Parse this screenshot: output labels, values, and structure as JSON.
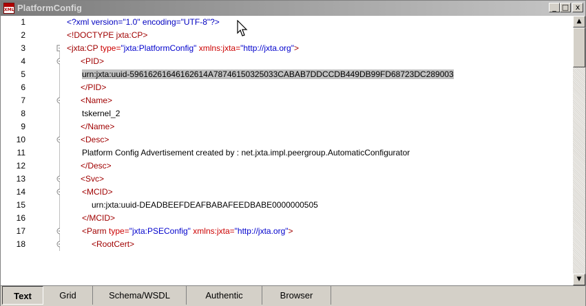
{
  "window": {
    "title": "PlatformConfig",
    "icon": "xml-file-icon",
    "icon_text": "XML",
    "controls": {
      "minimize": "_",
      "maximize": "□",
      "close": "x"
    }
  },
  "lines": [
    {
      "n": "1",
      "fold": "none",
      "indent": 0,
      "parts": [
        {
          "c": "pi",
          "t": "<?xml version=\"1.0\" encoding=\"UTF-8\"?>"
        }
      ]
    },
    {
      "n": "2",
      "fold": "none",
      "indent": 0,
      "parts": [
        {
          "c": "tag",
          "t": "<!DOCTYPE jxta:CP>"
        }
      ]
    },
    {
      "n": "3",
      "fold": "box",
      "indent": 0,
      "parts": [
        {
          "c": "tag",
          "t": "<jxta:CP"
        },
        {
          "c": "attr",
          "t": " type="
        },
        {
          "c": "val",
          "t": "\"jxta:PlatformConfig\""
        },
        {
          "c": "attr",
          "t": " xmlns:jxta="
        },
        {
          "c": "val",
          "t": "\"http://jxta.org\""
        },
        {
          "c": "tag",
          "t": ">"
        }
      ]
    },
    {
      "n": "4",
      "fold": "open",
      "indent": 1,
      "parts": [
        {
          "c": "tag",
          "t": "<PID>"
        }
      ]
    },
    {
      "n": "5",
      "fold": "bar",
      "indent": 2,
      "parts": [
        {
          "c": "text sel",
          "t": "urn:jxta:uuid-59616261646162614A78746150325033CABAB7DDCCDB449DB99FD68723DC289003"
        }
      ]
    },
    {
      "n": "6",
      "fold": "end",
      "indent": 1,
      "parts": [
        {
          "c": "tag",
          "t": "</PID>"
        }
      ]
    },
    {
      "n": "7",
      "fold": "open",
      "indent": 1,
      "parts": [
        {
          "c": "tag",
          "t": "<Name>"
        }
      ]
    },
    {
      "n": "8",
      "fold": "bar",
      "indent": 2,
      "parts": [
        {
          "c": "text",
          "t": "tskernel_2"
        }
      ]
    },
    {
      "n": "9",
      "fold": "end",
      "indent": 1,
      "parts": [
        {
          "c": "tag",
          "t": "</Name>"
        }
      ]
    },
    {
      "n": "10",
      "fold": "open",
      "indent": 1,
      "parts": [
        {
          "c": "tag",
          "t": "<Desc>"
        }
      ]
    },
    {
      "n": "11",
      "fold": "bar",
      "indent": 2,
      "parts": [
        {
          "c": "text",
          "t": "Platform Config Advertisement created by : net.jxta.impl.peergroup.AutomaticConfigurator"
        }
      ]
    },
    {
      "n": "12",
      "fold": "end",
      "indent": 1,
      "parts": [
        {
          "c": "tag",
          "t": "</Desc>"
        }
      ]
    },
    {
      "n": "13",
      "fold": "open",
      "indent": 1,
      "parts": [
        {
          "c": "tag",
          "t": "<Svc>"
        }
      ]
    },
    {
      "n": "14",
      "fold": "open2",
      "indent": 2,
      "parts": [
        {
          "c": "tag",
          "t": "<MCID>"
        }
      ]
    },
    {
      "n": "15",
      "fold": "bar2",
      "indent": 3,
      "parts": [
        {
          "c": "text",
          "t": "urn:jxta:uuid-DEADBEEFDEAFBABAFEEDBABE0000000505"
        }
      ]
    },
    {
      "n": "16",
      "fold": "end2",
      "indent": 2,
      "parts": [
        {
          "c": "tag",
          "t": "</MCID>"
        }
      ]
    },
    {
      "n": "17",
      "fold": "open2",
      "indent": 2,
      "parts": [
        {
          "c": "tag",
          "t": "<Parm"
        },
        {
          "c": "attr",
          "t": " type="
        },
        {
          "c": "val",
          "t": "\"jxta:PSEConfig\""
        },
        {
          "c": "attr",
          "t": " xmlns:jxta="
        },
        {
          "c": "val",
          "t": "\"http://jxta.org\""
        },
        {
          "c": "tag",
          "t": ">"
        }
      ]
    },
    {
      "n": "18",
      "fold": "open3",
      "indent": 3,
      "parts": [
        {
          "c": "tag",
          "t": "<RootCert>"
        }
      ]
    }
  ],
  "tabs": [
    {
      "label": "Text",
      "active": true
    },
    {
      "label": "Grid",
      "active": false
    },
    {
      "label": "Schema/WSDL",
      "active": false
    },
    {
      "label": "Authentic",
      "active": false
    },
    {
      "label": "Browser",
      "active": false
    }
  ],
  "scrollbar": {
    "up": "▲",
    "down": "▼"
  }
}
